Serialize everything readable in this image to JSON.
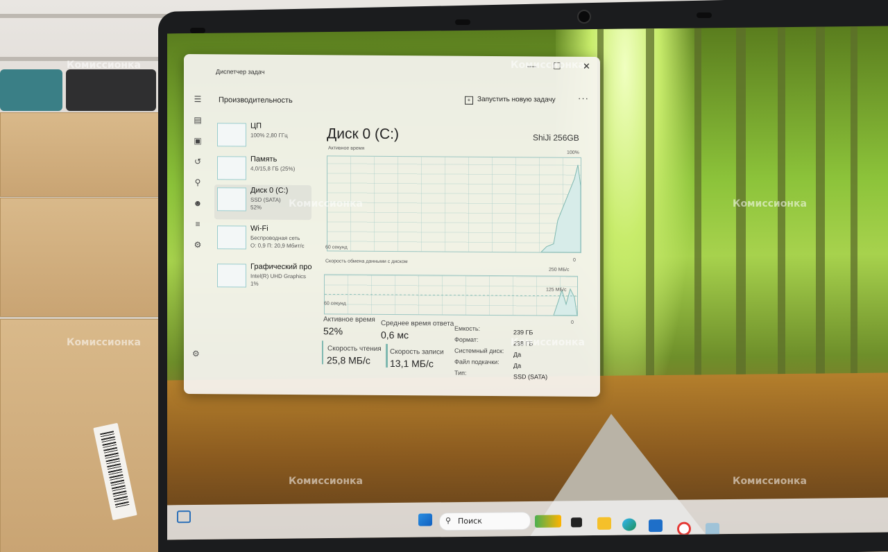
{
  "window": {
    "title": "Диспетчер задач",
    "minimize": "—",
    "maximize": "☐",
    "close": "✕"
  },
  "header": {
    "section": "Производительность",
    "new_task": "Запустить новую задачу",
    "more": "···"
  },
  "items": [
    {
      "title": "ЦП",
      "sub": "100% 2,80 ГГц",
      "sub2": ""
    },
    {
      "title": "Память",
      "sub": "4,0/15,8 ГБ (25%)",
      "sub2": ""
    },
    {
      "title": "Диск 0 (C:)",
      "sub": "SSD (SATA)",
      "sub2": "52%"
    },
    {
      "title": "Wi-Fi",
      "sub": "Беспроводная сеть",
      "sub2": "О: 0,9 П: 20,9 Мбит/с"
    },
    {
      "title": "Графический про",
      "sub": "Intel(R) UHD Graphics",
      "sub2": "1%"
    }
  ],
  "disk": {
    "title": "Диск 0 (C:)",
    "model": "ShiJi 256GB",
    "active_time_label": "Активное время",
    "max_100": "100%",
    "seconds_60": "60 секунд",
    "zero": "0",
    "transfer_label": "Скорость обмена данными с диском",
    "max_250": "250 МБ/с",
    "mid_125": "125 МБ/с"
  },
  "stats": {
    "active_lbl": "Активное время",
    "active_val": "52%",
    "resp_lbl": "Среднее время ответа",
    "resp_val": "0,6 мс",
    "read_lbl": "Скорость чтения",
    "read_val": "25,8 МБ/с",
    "write_lbl": "Скорость записи",
    "write_val": "13,1 МБ/с"
  },
  "props": [
    {
      "k": "Емкость:",
      "v": "239 ГБ"
    },
    {
      "k": "Формат:",
      "v": "238 ГБ"
    },
    {
      "k": "Системный диск:",
      "v": "Да"
    },
    {
      "k": "Файл подкачки:",
      "v": "Да"
    },
    {
      "k": "Тип:",
      "v": "SSD (SATA)"
    }
  ],
  "taskbar": {
    "search": "Поиск"
  },
  "watermark": "Комиссионка",
  "colors": {
    "graph_line": "#7fb8b0",
    "graph_fill": "#d7ece9"
  }
}
